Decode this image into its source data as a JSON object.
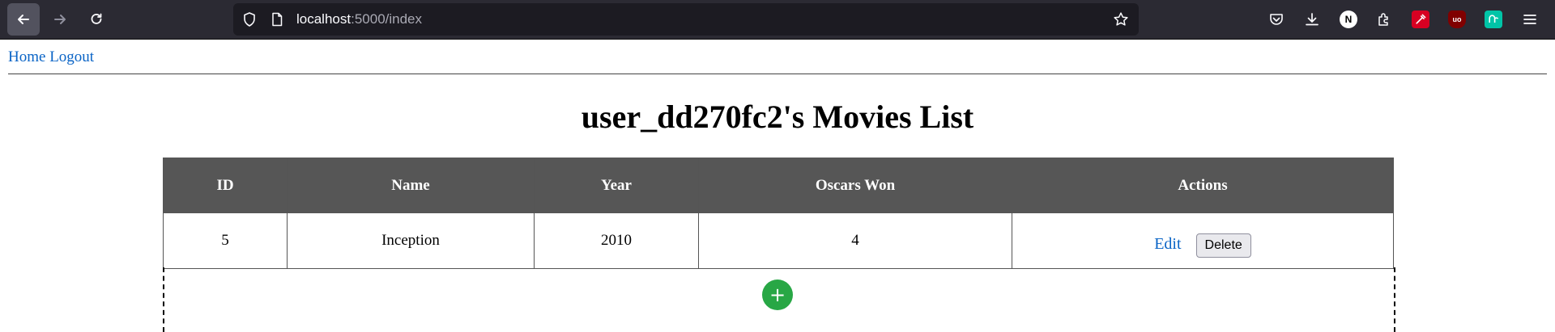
{
  "browser": {
    "url_host": "localhost",
    "url_path": ":5000/index",
    "extensions": [
      {
        "name": "pocket-icon"
      },
      {
        "name": "download-icon"
      },
      {
        "name": "notion-icon",
        "label": "N",
        "color": "#ffffff"
      },
      {
        "name": "extensions-icon"
      },
      {
        "name": "eyedropper-icon",
        "color": "#d70022"
      },
      {
        "name": "ublock-icon",
        "color": "#800000"
      },
      {
        "name": "green-extension-icon",
        "color": "#00c4a7"
      },
      {
        "name": "menu-icon"
      }
    ]
  },
  "nav": {
    "home": "Home",
    "logout": "Logout"
  },
  "page": {
    "title": "user_dd270fc2's Movies List"
  },
  "table": {
    "headers": {
      "id": "ID",
      "name": "Name",
      "year": "Year",
      "oscars": "Oscars Won",
      "actions": "Actions"
    },
    "rows": [
      {
        "id": "5",
        "name": "Inception",
        "year": "2010",
        "oscars": "4",
        "edit": "Edit",
        "delete": "Delete"
      }
    ]
  },
  "add_button": {
    "label": "+",
    "color": "#28a745"
  }
}
